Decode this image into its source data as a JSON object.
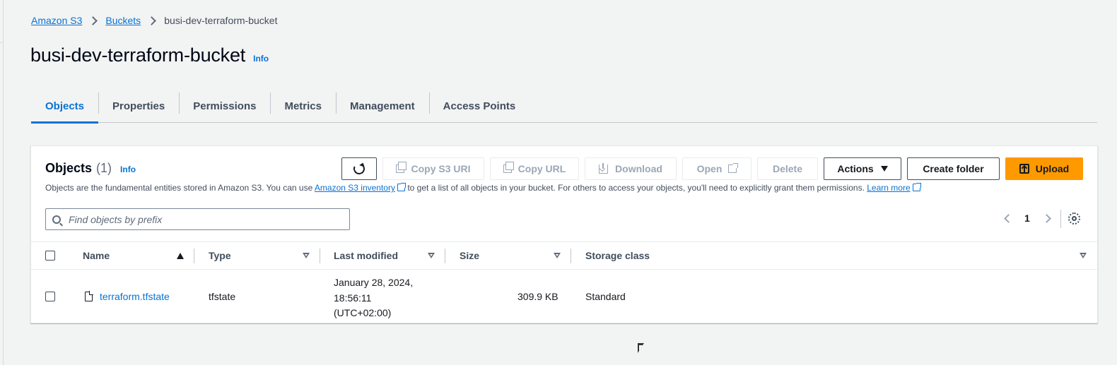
{
  "breadcrumb": {
    "items": [
      "Amazon S3",
      "Buckets"
    ],
    "current": "busi-dev-terraform-bucket"
  },
  "page": {
    "title": "busi-dev-terraform-bucket",
    "info": "Info"
  },
  "tabs": [
    {
      "label": "Objects",
      "active": true
    },
    {
      "label": "Properties"
    },
    {
      "label": "Permissions"
    },
    {
      "label": "Metrics"
    },
    {
      "label": "Management"
    },
    {
      "label": "Access Points"
    }
  ],
  "objects_panel": {
    "title": "Objects",
    "count": "(1)",
    "info": "Info",
    "description_prefix": "Objects are the fundamental entities stored in Amazon S3. You can use ",
    "inventory_link": "Amazon S3 inventory",
    "description_middle": " to get a list of all objects in your bucket. For others to access your objects, you'll need to explicitly grant them permissions. ",
    "learn_more": "Learn more",
    "buttons": {
      "copy_s3_uri": "Copy S3 URI",
      "copy_url": "Copy URL",
      "download": "Download",
      "open": "Open",
      "delete": "Delete",
      "actions": "Actions",
      "create_folder": "Create folder",
      "upload": "Upload"
    },
    "search": {
      "placeholder": "Find objects by prefix"
    },
    "pagination": {
      "current_page": "1"
    }
  },
  "table": {
    "columns": [
      "Name",
      "Type",
      "Last modified",
      "Size",
      "Storage class"
    ],
    "sort": {
      "column": "Name",
      "direction": "ascending"
    },
    "rows": [
      {
        "name": "terraform.tfstate",
        "type": "tfstate",
        "last_modified_line1": "January 28, 2024,",
        "last_modified_line2": "18:56:11",
        "last_modified_line3": "(UTC+02:00)",
        "size": "309.9 KB",
        "storage_class": "Standard"
      }
    ]
  },
  "colors": {
    "link": "#0972d3",
    "primary_button": "#ff9900",
    "page_background": "#f2f3f3"
  }
}
